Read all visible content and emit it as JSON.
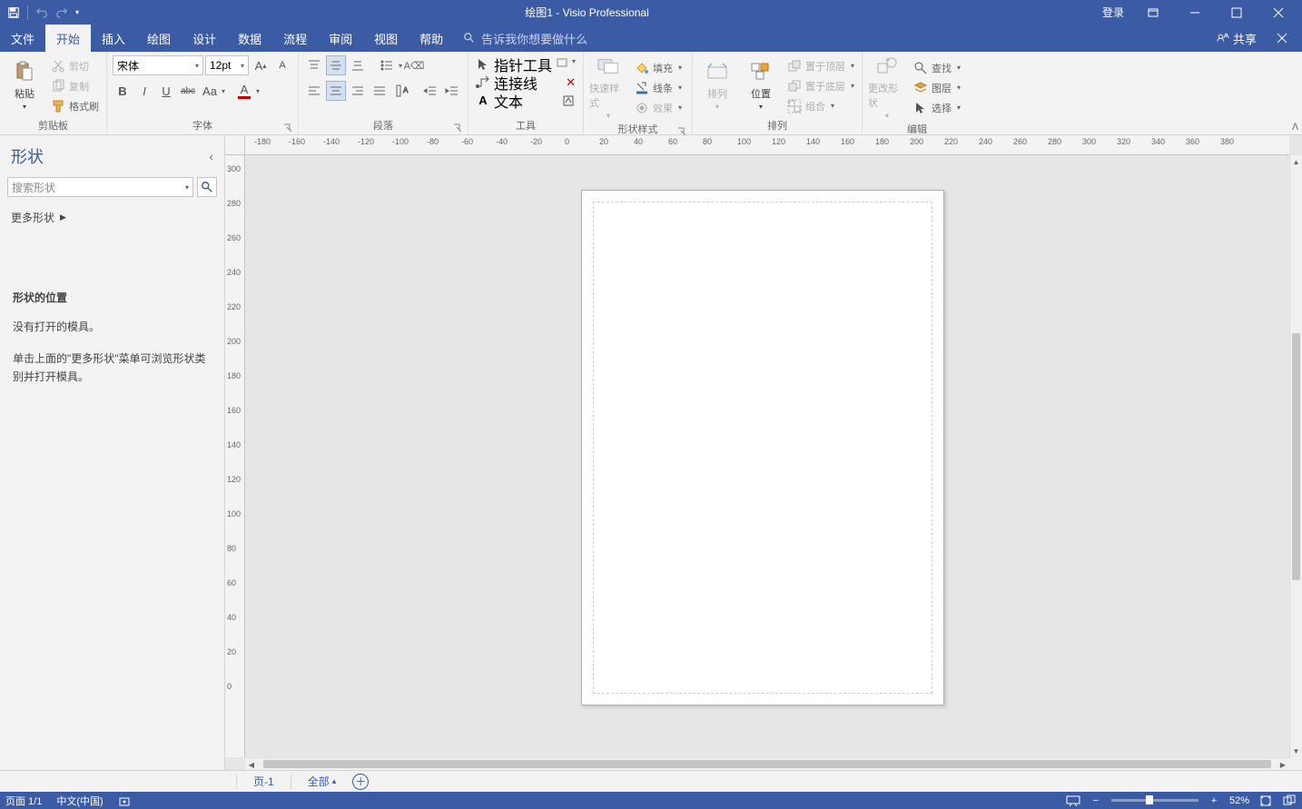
{
  "titlebar": {
    "doc_title": "绘图1",
    "sep": "  -  ",
    "app_title": "Visio Professional",
    "login": "登录"
  },
  "tabs": {
    "file": "文件",
    "home": "开始",
    "insert": "插入",
    "draw": "绘图",
    "design": "设计",
    "data": "数据",
    "process": "流程",
    "review": "审阅",
    "view": "视图",
    "help": "帮助",
    "tellme_placeholder": "告诉我你想要做什么"
  },
  "tabright": {
    "share": "共享"
  },
  "ribbon": {
    "clipboard": {
      "paste": "粘贴",
      "cut": "剪切",
      "copy": "复制",
      "format_painter": "格式刷",
      "label": "剪贴板"
    },
    "font": {
      "name": "宋体",
      "size": "12pt",
      "aa": "Aa",
      "label": "字体"
    },
    "paragraph": {
      "label": "段落"
    },
    "tools": {
      "pointer": "指针工具",
      "connector": "连接线",
      "text": "文本",
      "label": "工具"
    },
    "styles": {
      "quick": "快速样式",
      "fill": "填充",
      "line": "线条",
      "effect": "效果",
      "label": "形状样式"
    },
    "arrange": {
      "arrange": "排列",
      "position": "位置",
      "front": "置于顶层",
      "back": "置于底层",
      "group": "组合",
      "label": "排列"
    },
    "edit": {
      "change_shape": "更改形状",
      "find": "查找",
      "layer": "图层",
      "select": "选择",
      "label": "编辑"
    }
  },
  "shapes": {
    "title": "形状",
    "search_placeholder": "搜索形状",
    "more": "更多形状",
    "pos_title": "形状的位置",
    "no_stencil": "没有打开的模具。",
    "hint": "单击上面的\"更多形状\"菜单可浏览形状类别并打开模具。"
  },
  "rulers": {
    "h": [
      "-180",
      "-160",
      "-140",
      "-120",
      "-100",
      "-80",
      "-60",
      "-40",
      "-20",
      "0",
      "20",
      "40",
      "60",
      "80",
      "100",
      "120",
      "140",
      "160",
      "180",
      "200",
      "220",
      "240",
      "260",
      "280",
      "300",
      "320",
      "340",
      "360",
      "380"
    ],
    "v": [
      "300",
      "280",
      "260",
      "240",
      "220",
      "200",
      "180",
      "160",
      "140",
      "120",
      "100",
      "80",
      "60",
      "40",
      "20",
      "0"
    ]
  },
  "pagetabs": {
    "page1": "页-1",
    "all": "全部"
  },
  "status": {
    "page": "页面 1/1",
    "lang": "中文(中国)",
    "zoom": "52%"
  }
}
